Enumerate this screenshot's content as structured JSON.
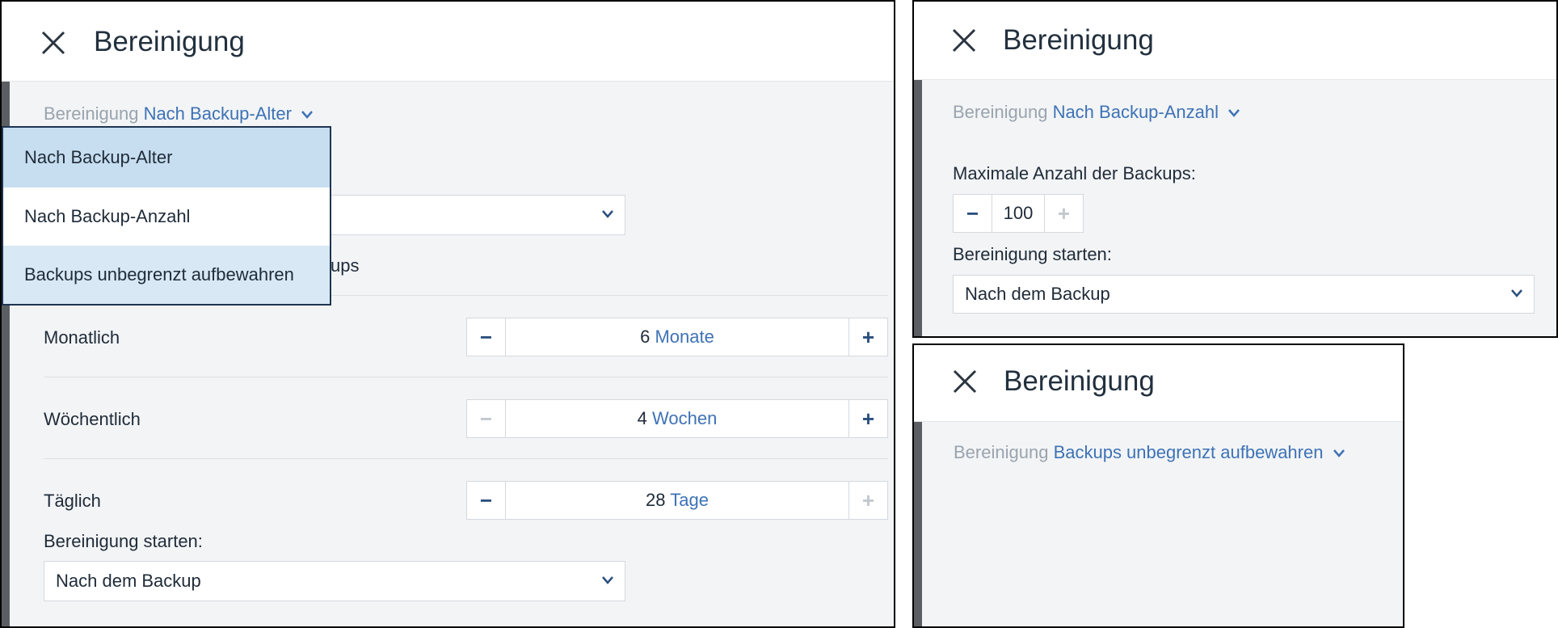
{
  "panel_age": {
    "title": "Bereinigung",
    "mode_label": "Bereinigung",
    "mode_value": "Nach Backup-Alter",
    "dropdown_options": [
      "Nach Backup-Alter",
      "Nach Backup-Anzahl",
      "Backups unbegrenzt aufbewahren"
    ],
    "hidden_text_fragment": "ups",
    "rows": [
      {
        "label": "Monatlich",
        "value": "6",
        "unit": "Monate"
      },
      {
        "label": "Wöchentlich",
        "value": "4",
        "unit": "Wochen"
      },
      {
        "label": "Täglich",
        "value": "28",
        "unit": "Tage"
      }
    ],
    "start_label": "Bereinigung starten:",
    "start_value": "Nach dem Backup",
    "minus_symbol": "−",
    "plus_symbol": "+"
  },
  "panel_count": {
    "title": "Bereinigung",
    "mode_label": "Bereinigung",
    "mode_value": "Nach Backup-Anzahl",
    "max_label": "Maximale Anzahl der Backups:",
    "max_value": "100",
    "start_label": "Bereinigung starten:",
    "start_value": "Nach dem Backup",
    "minus_symbol": "−",
    "plus_symbol": "+"
  },
  "panel_unlimited": {
    "title": "Bereinigung",
    "mode_label": "Bereinigung",
    "mode_value": "Backups unbegrenzt aufbewahren"
  },
  "colors": {
    "accent": "#3e72b5",
    "muted_label": "#9aa4ae",
    "selected_option": "#c7def1",
    "background": "#f2f4f6"
  }
}
